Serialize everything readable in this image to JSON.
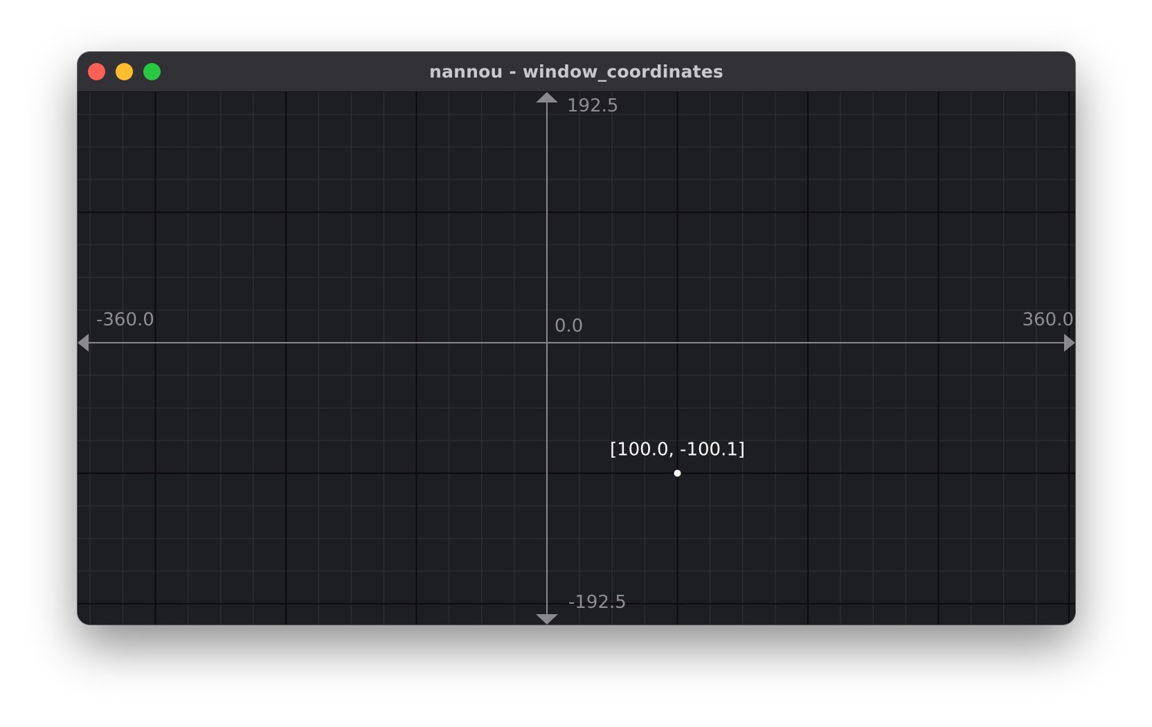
{
  "window": {
    "title": "nannou - window_coordinates",
    "controls": [
      {
        "name": "close",
        "color": "#fe5f57"
      },
      {
        "name": "minimize",
        "color": "#febc2e"
      },
      {
        "name": "zoom",
        "color": "#28c840"
      }
    ]
  },
  "canvas": {
    "background": "#1d1e21",
    "grid_minor_color": "#2b2c30",
    "grid_major_color": "#0b0b0d",
    "axis_color": "#8a8a8e",
    "x_range": [
      -360.0,
      360.0
    ],
    "y_range": [
      -192.5,
      192.5
    ],
    "minor_step": 25,
    "major_step": 100,
    "labels": {
      "x_min": "-360.0",
      "x_max": "360.0",
      "y_max": "192.5",
      "y_min": "-192.5",
      "origin": "0.0"
    },
    "point": {
      "x": 100.0,
      "y": -100.0,
      "label": "[100.0, -100.1]"
    }
  }
}
